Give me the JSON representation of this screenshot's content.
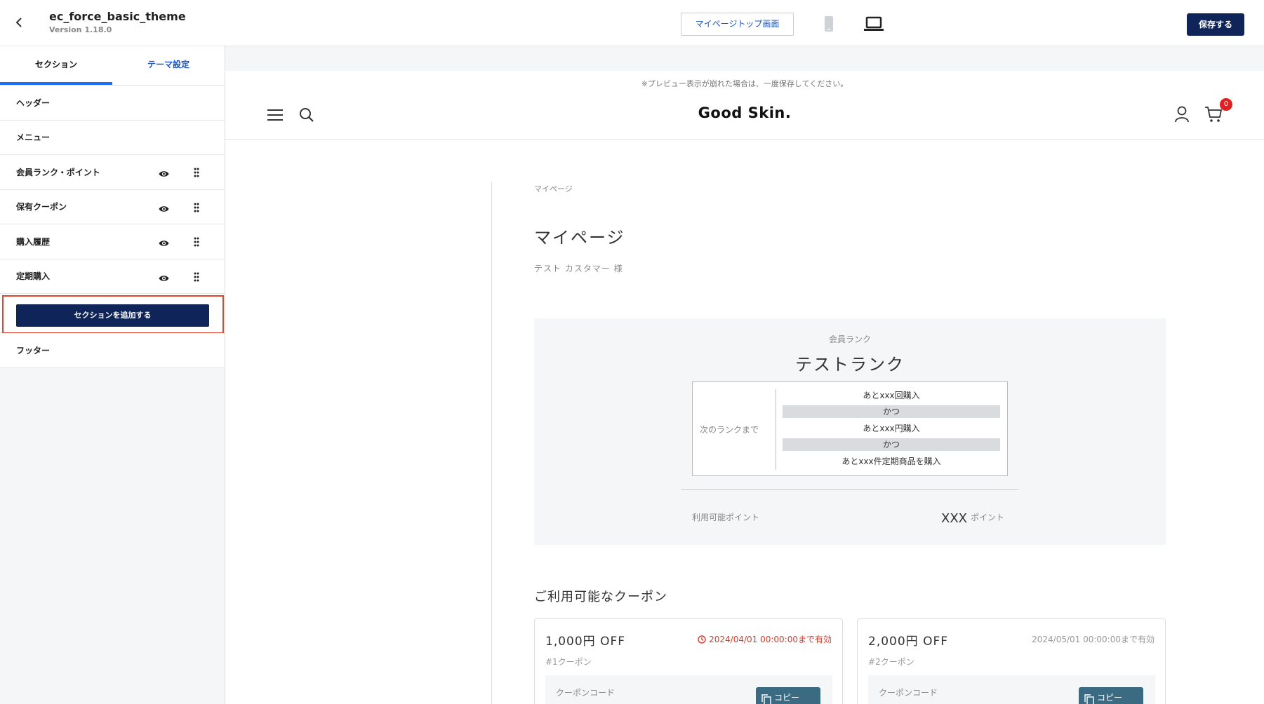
{
  "topbar": {
    "title": "ec_force_basic_theme",
    "version": "Version 1.18.0",
    "mypage_button": "マイページトップ画面",
    "save_button": "保存する"
  },
  "sidebar": {
    "tabs": [
      {
        "label": "セクション",
        "active": true
      },
      {
        "label": "テーマ設定",
        "active": false
      }
    ],
    "items": [
      {
        "label": "ヘッダー"
      },
      {
        "label": "メニュー"
      },
      {
        "label": "会員ランク・ポイント",
        "controls": true
      },
      {
        "label": "保有クーポン",
        "controls": true
      },
      {
        "label": "購入履歴",
        "controls": true
      },
      {
        "label": "定期購入",
        "controls": true
      }
    ],
    "add_button": "セクションを追加する",
    "footer_item": "フッター"
  },
  "preview": {
    "notice": "※プレビュー表示が崩れた場合は、一度保存してください。",
    "logo": "Good Skin.",
    "cart_count": "0",
    "breadcrumb": "マイページ",
    "page_title": "マイページ",
    "customer": "テスト カスタマー 様",
    "rank": {
      "label": "会員ランク",
      "name": "テストランク",
      "next_label": "次のランクまで",
      "conditions": [
        "あとxxx回購入",
        "かつ",
        "あとxxx円購入",
        "かつ",
        "あとxxx件定期商品を購入"
      ],
      "points_label": "利用可能ポイント",
      "points_value": "XXX",
      "points_unit": "ポイント"
    },
    "coupon_heading": "ご利用可能なクーポン",
    "coupons": [
      {
        "amount": "1,000円 OFF",
        "expiry": "2024/04/01 00:00:00まで有効",
        "expiry_color": "#d93a2b",
        "name": "#1クーポン",
        "code_label": "クーポンコード",
        "copy": "コピー"
      },
      {
        "amount": "2,000円 OFF",
        "expiry": "2024/05/01 00:00:00まで有効",
        "name": "#2クーポン",
        "code_label": "クーポンコード",
        "copy": "コピー"
      }
    ]
  },
  "colors": {
    "navy": "#0f2458",
    "accent_blue": "#1d6ef0",
    "highlight_red": "#e8412c"
  }
}
